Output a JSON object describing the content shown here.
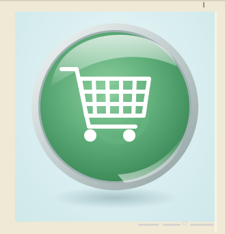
{
  "image": {
    "subject": "shopping-cart-icon",
    "colors": {
      "background": "#efe9d6",
      "panel": "#d9eef0",
      "button_green": "#5fae7a",
      "button_dark_green": "#3e8c5a",
      "rim_silver": "#c9d3d3",
      "cart_white": "#ffffff"
    }
  }
}
